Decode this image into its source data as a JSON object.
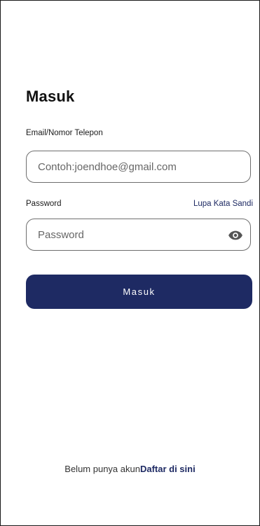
{
  "page": {
    "title": "Masuk"
  },
  "form": {
    "email": {
      "label": "Email/Nomor Telepon",
      "placeholder": "Contoh:joendhoe@gmail.com",
      "value": ""
    },
    "password": {
      "label": "Password",
      "placeholder": "Password",
      "value": "",
      "forgot_link": "Lupa Kata Sandi",
      "toggle_icon": "eye-icon"
    },
    "submit_label": "Masuk"
  },
  "footer": {
    "prompt": "Belum punya akun",
    "register_link": "Daftar di sini"
  },
  "colors": {
    "primary": "#1e2a63",
    "border": "#6e6e6e",
    "text": "#111111"
  }
}
